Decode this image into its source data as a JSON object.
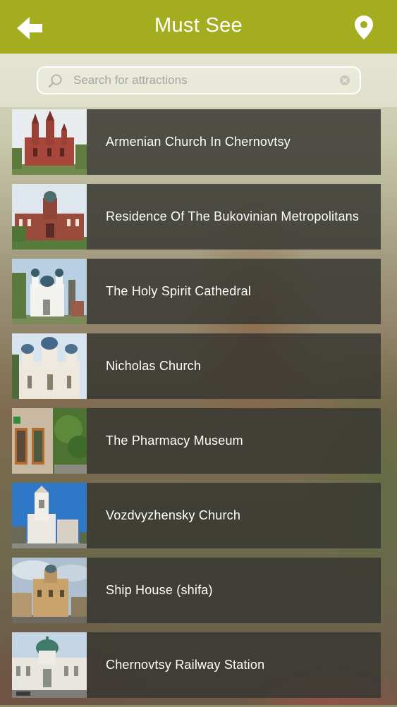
{
  "header": {
    "title": "Must See",
    "back_icon": "back-arrow-icon",
    "location_icon": "location-pin-icon",
    "bar_color": "#a4ad1f"
  },
  "search": {
    "placeholder": "Search for attractions",
    "value": ""
  },
  "attractions": [
    {
      "label": "Armenian Church In Chernovtsy",
      "thumb": "red-brick-church"
    },
    {
      "label": "Residence Of The Bukovinian Metropolitans",
      "thumb": "brick-residence"
    },
    {
      "label": "The Holy Spirit Cathedral",
      "thumb": "white-cathedral-with-statue"
    },
    {
      "label": "Nicholas Church",
      "thumb": "blue-domed-church"
    },
    {
      "label": "The Pharmacy Museum",
      "thumb": "museum-facade"
    },
    {
      "label": "Vozdvyzhensky Church",
      "thumb": "white-church-tower"
    },
    {
      "label": "Ship House (shifa)",
      "thumb": "ship-house"
    },
    {
      "label": "Chernovtsy Railway Station",
      "thumb": "railway-station"
    }
  ]
}
